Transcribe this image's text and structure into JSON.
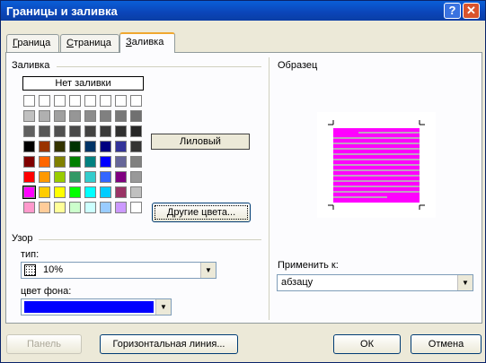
{
  "window": {
    "title": "Границы и заливка",
    "help": "?",
    "close": "✕"
  },
  "tabs": [
    {
      "label": "Граница",
      "accel": "Г",
      "rest": "раница"
    },
    {
      "label": "Страница",
      "accel": "С",
      "rest": "траница"
    },
    {
      "label": "Заливка",
      "accel": "З",
      "rest": "аливка"
    }
  ],
  "fill": {
    "group_label": "Заливка",
    "no_fill": "Нет заливки",
    "selected_color_name": "Лиловый",
    "more_colors": "Другие цвета...",
    "palette": [
      [
        "#ffffff",
        "#ffffff",
        "#ffffff",
        "#ffffff",
        "#ffffff",
        "#ffffff",
        "#ffffff",
        "#ffffff"
      ],
      [
        "#c0c0c0",
        "#b0b0b0",
        "#a0a0a0",
        "#969696",
        "#8c8c8c",
        "#808080",
        "#777777",
        "#707070"
      ],
      [
        "#606060",
        "#585858",
        "#505050",
        "#494949",
        "#424242",
        "#3a3a3a",
        "#303030",
        "#262626"
      ],
      [
        "#000000",
        "#993300",
        "#333300",
        "#003300",
        "#003366",
        "#000080",
        "#333399",
        "#333333"
      ],
      [
        "#800000",
        "#ff6600",
        "#808000",
        "#008000",
        "#008080",
        "#0000ff",
        "#666699",
        "#808080"
      ],
      [
        "#ff0000",
        "#ff9900",
        "#99cc00",
        "#339966",
        "#33cccc",
        "#3366ff",
        "#800080",
        "#999999"
      ],
      [
        "#ff00ff",
        "#ffcc00",
        "#ffff00",
        "#00ff00",
        "#00ffff",
        "#00ccff",
        "#993366",
        "#c0c0c0"
      ],
      [
        "#ff99cc",
        "#ffcc99",
        "#ffff99",
        "#ccffcc",
        "#ccffff",
        "#99ccff",
        "#cc99ff",
        "#ffffff"
      ]
    ]
  },
  "pattern": {
    "group_label": "Узор",
    "type_label": "тип:",
    "type_value": "10%",
    "bg_label": "цвет фона:",
    "bg_color": "#0000ff"
  },
  "preview": {
    "label": "Образец",
    "fill_color": "#ff00ff"
  },
  "apply": {
    "label": "Применить к:",
    "value": "абзацу"
  },
  "buttons": {
    "panel": "Панель",
    "hline": "Горизонтальная линия...",
    "ok": "ОК",
    "cancel": "Отмена"
  }
}
